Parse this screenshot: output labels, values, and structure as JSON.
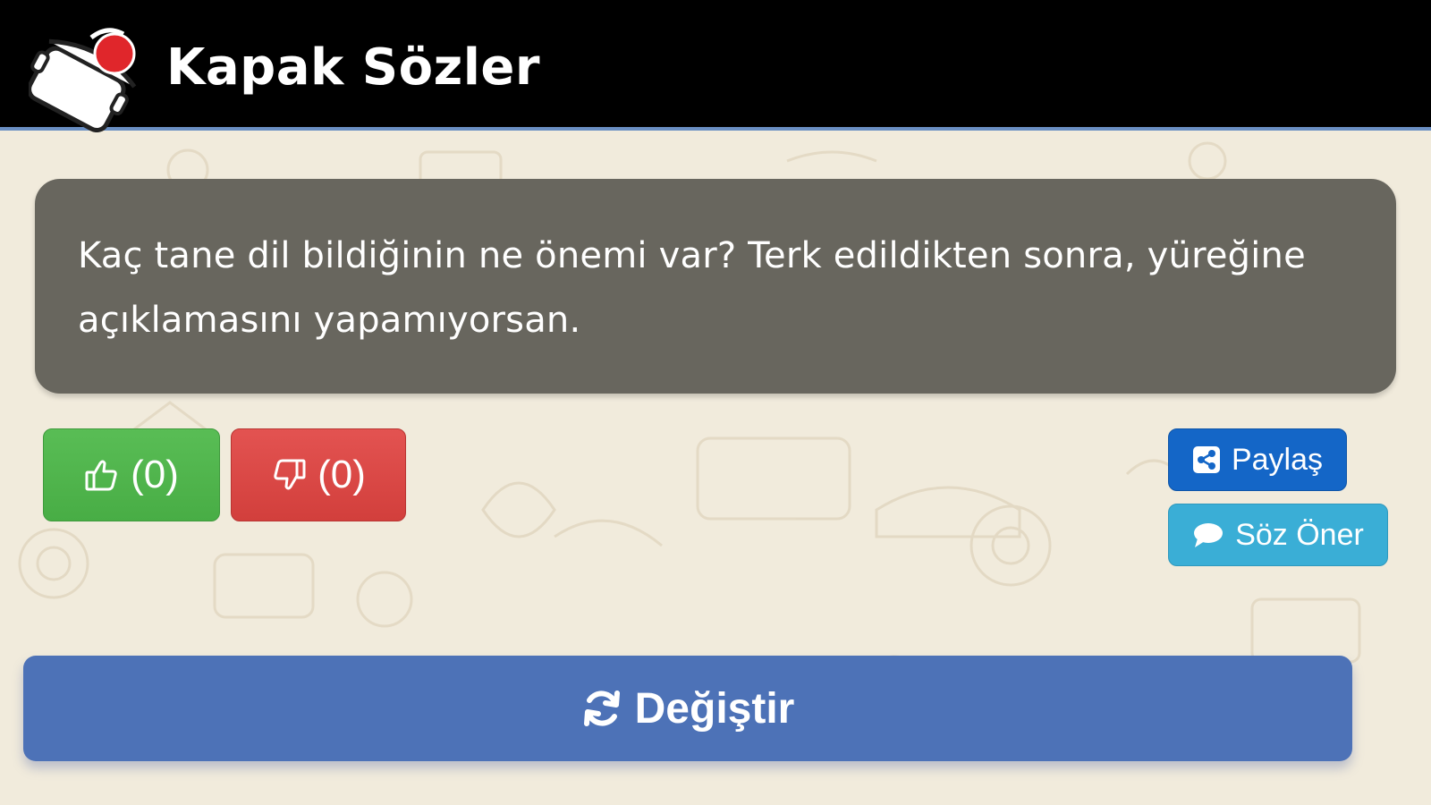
{
  "header": {
    "title": "Kapak Sözler",
    "logo_icon": "pot-lid-logo-icon"
  },
  "quote": {
    "text": "Kaç tane dil bildiğinin ne önemi var? Terk edildikten sonra, yüreğine açıklamasını yapamıyorsan."
  },
  "actions": {
    "like_count": "(0)",
    "dislike_count": "(0)",
    "share_label": "Paylaş",
    "suggest_label": "Söz Öner",
    "change_label": "Değiştir"
  },
  "icons": {
    "like": "thumbs-up-icon",
    "dislike": "thumbs-down-icon",
    "share": "share-icon",
    "suggest": "comment-icon",
    "change": "refresh-icon"
  },
  "colors": {
    "header_bg": "#000000",
    "background": "#f1ebdc",
    "quote_card": "#68665e",
    "like": "#4fb54c",
    "dislike": "#d94643",
    "share": "#1466c7",
    "suggest": "#3aaed6",
    "change": "#4d72b7"
  }
}
